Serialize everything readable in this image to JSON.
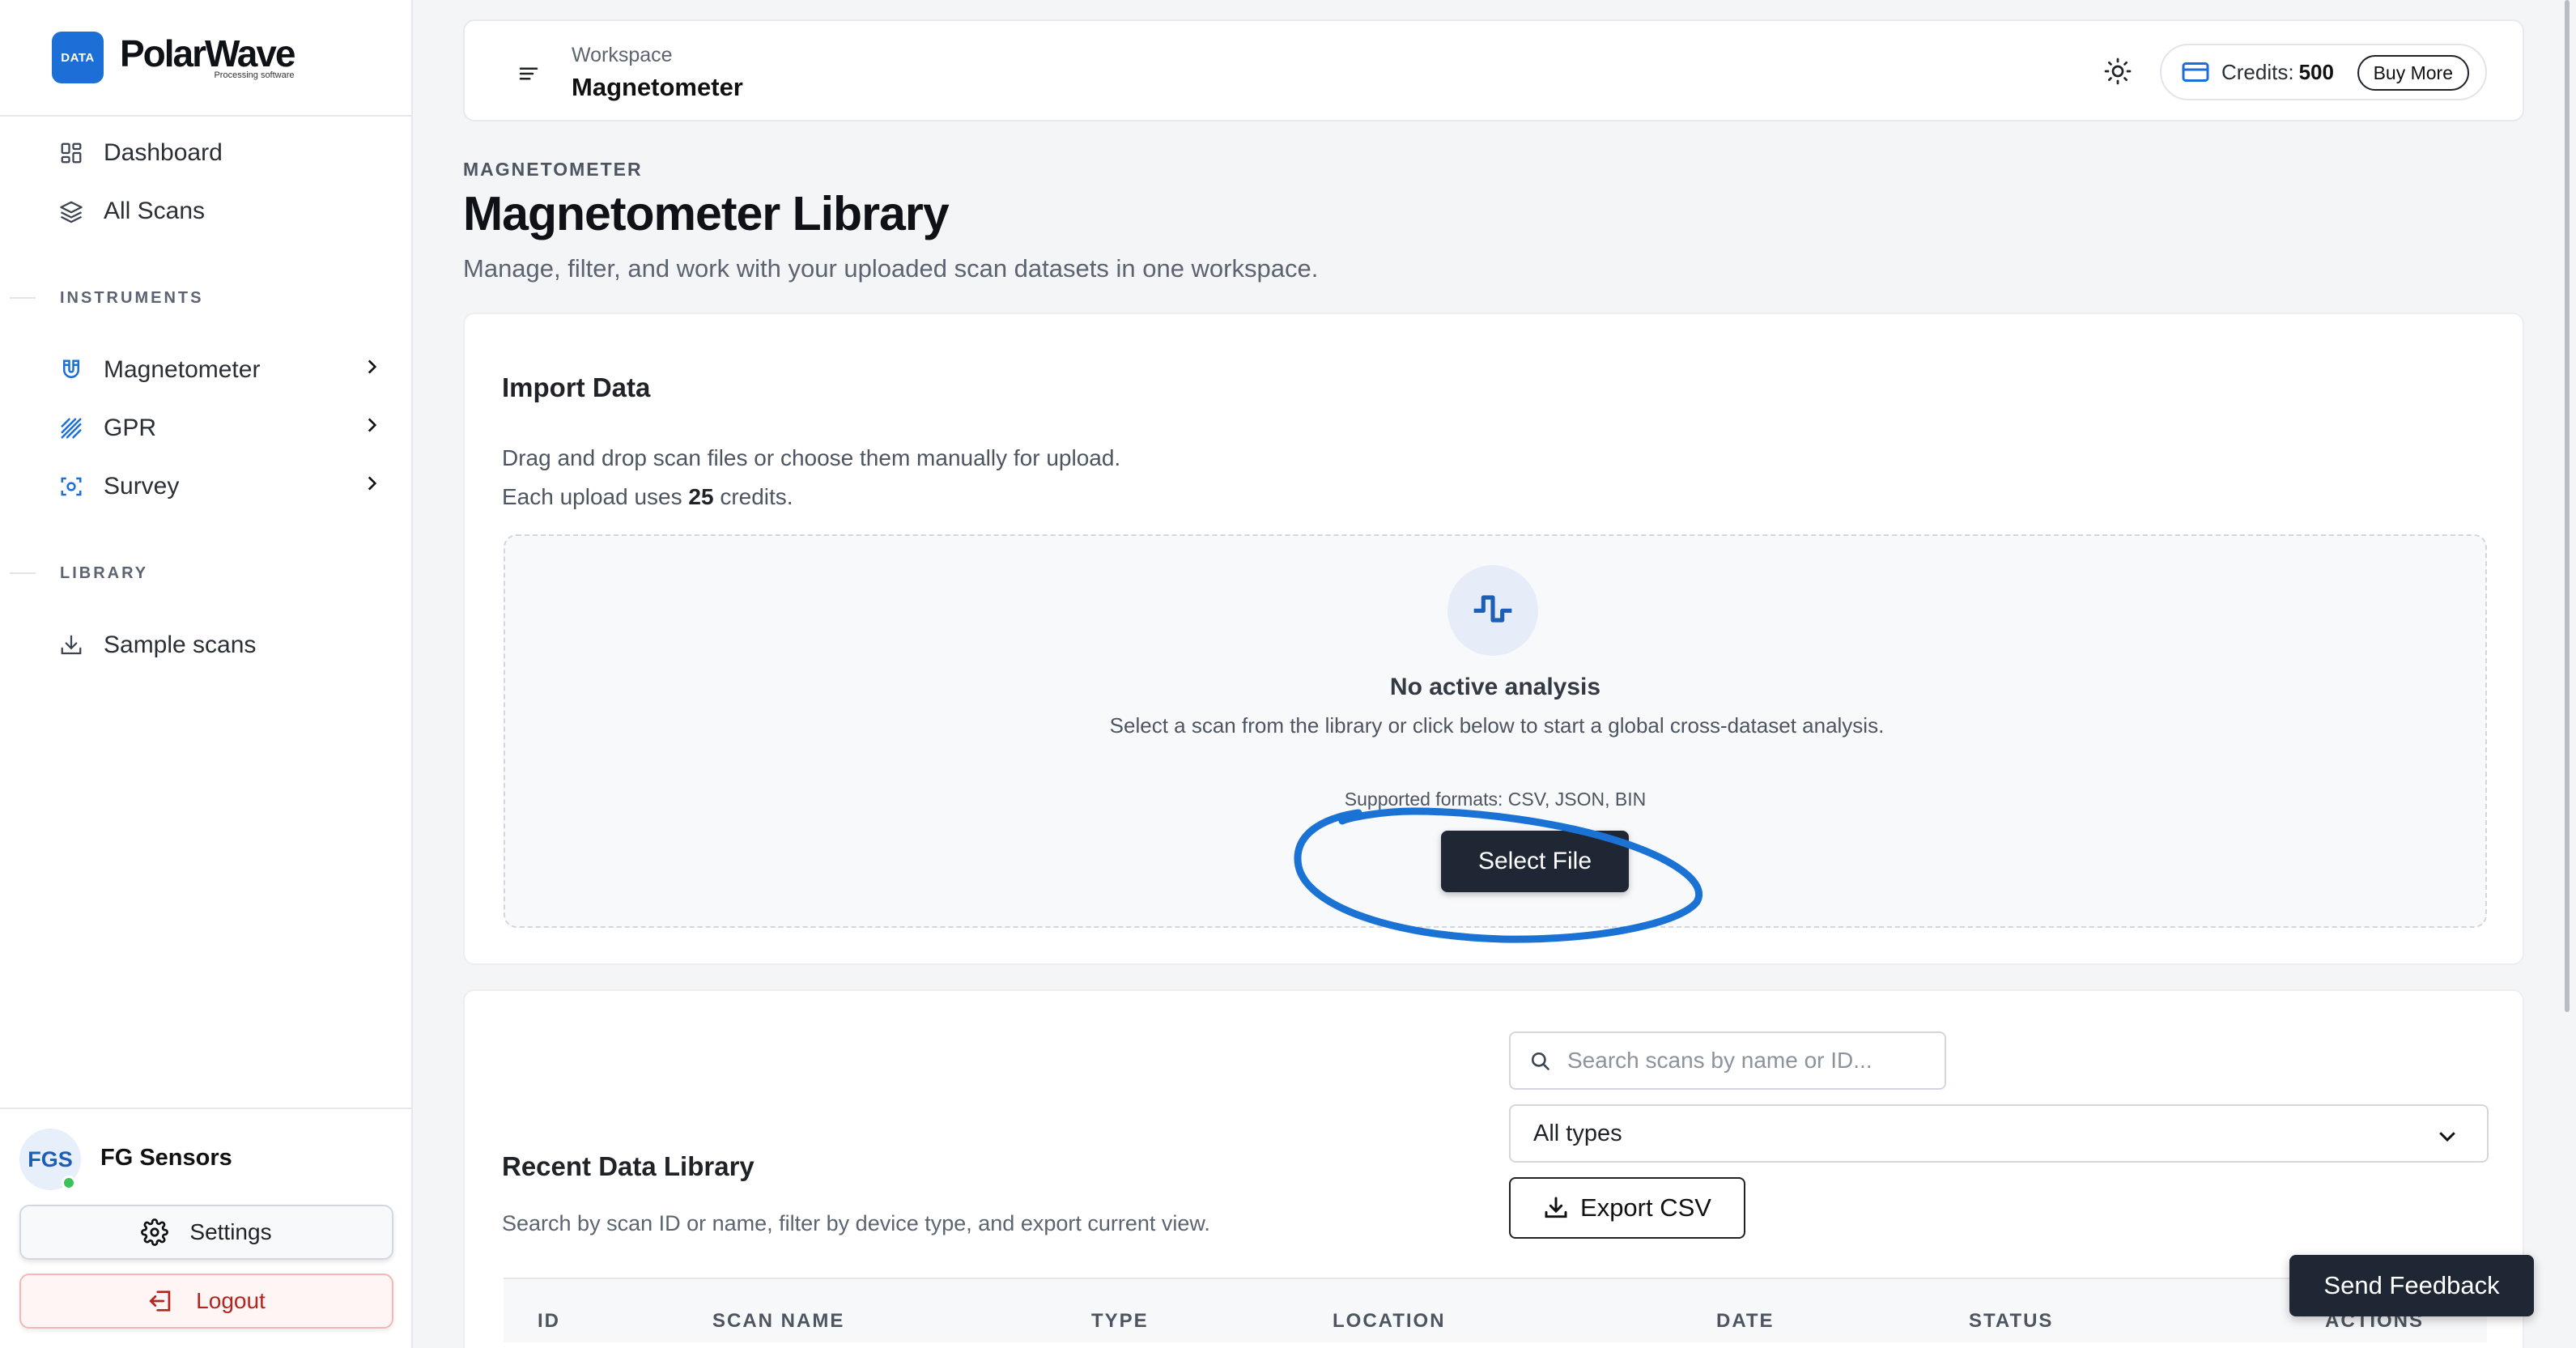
{
  "brand": {
    "badge": "DATA",
    "name": "PolarWave",
    "tagline": "Processing software"
  },
  "sidebar": {
    "top_items": [
      {
        "label": "Dashboard",
        "icon": "dashboard-grid-icon"
      },
      {
        "label": "All Scans",
        "icon": "layers-icon"
      }
    ],
    "instruments_label": "INSTRUMENTS",
    "instruments": [
      {
        "label": "Magnetometer",
        "icon": "magnet-icon"
      },
      {
        "label": "GPR",
        "icon": "hatch-lines-icon"
      },
      {
        "label": "Survey",
        "icon": "scan-focus-icon"
      }
    ],
    "library_label": "LIBRARY",
    "library_items": [
      {
        "label": "Sample scans",
        "icon": "download-icon"
      }
    ]
  },
  "user": {
    "initials": "FGS",
    "name": "FG Sensors",
    "online": true,
    "settings_label": "Settings",
    "logout_label": "Logout"
  },
  "topbar": {
    "workspace_label": "Workspace",
    "workspace_name": "Magnetometer",
    "credits_label": "Credits:",
    "credits_value": "500",
    "buy_label": "Buy More"
  },
  "page": {
    "eyebrow": "MAGNETOMETER",
    "title": "Magnetometer Library",
    "subtitle": "Manage, filter, and work with your uploaded scan datasets in one workspace."
  },
  "import": {
    "title": "Import Data",
    "desc_line1": "Drag and drop scan files or choose them manually for upload.",
    "desc_line2_prefix": "Each upload uses",
    "desc_line2_value": "25",
    "desc_line2_suffix": "credits.",
    "empty_title": "No active analysis",
    "empty_text": "Select a scan from the library or click below to start a global cross-dataset analysis.",
    "formats": "Supported formats: CSV, JSON, BIN",
    "select_label": "Select File"
  },
  "library": {
    "title": "Recent Data Library",
    "desc": "Search by scan ID or name, filter by device type, and export current view.",
    "search_placeholder": "Search scans by name or ID...",
    "type_selected": "All types",
    "export_label": "Export CSV",
    "columns": [
      "ID",
      "SCAN NAME",
      "TYPE",
      "LOCATION",
      "DATE",
      "STATUS",
      "ACTIONS"
    ]
  },
  "feedback_label": "Send Feedback",
  "colors": {
    "accent": "#1d6fd8",
    "dark_button": "#1e2733",
    "annotation": "#1a73d4",
    "danger": "#b3261e",
    "online": "#3cc25a"
  }
}
